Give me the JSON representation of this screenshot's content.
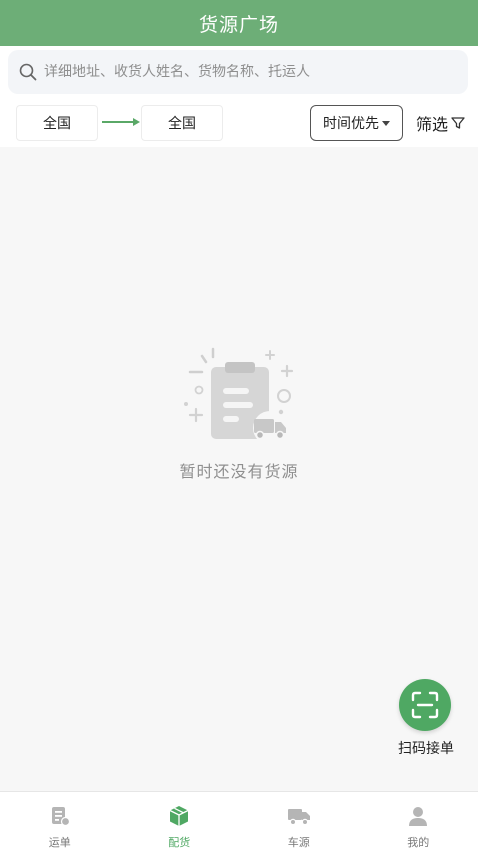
{
  "header": {
    "title": "货源广场"
  },
  "search": {
    "placeholder": "详细地址、收货人姓名、货物名称、托运人"
  },
  "filters": {
    "from_region": "全国",
    "to_region": "全国",
    "sort_label": "时间优先",
    "filter_label": "筛选"
  },
  "empty_state": {
    "message": "暂时还没有货源"
  },
  "scan": {
    "label": "扫码接单"
  },
  "bottom_nav": {
    "items": [
      {
        "label": "运单",
        "icon": "waybill-icon",
        "active": false
      },
      {
        "label": "配货",
        "icon": "box-icon",
        "active": true
      },
      {
        "label": "车源",
        "icon": "truck-icon",
        "active": false
      },
      {
        "label": "我的",
        "icon": "user-icon",
        "active": false
      }
    ]
  },
  "colors": {
    "brand": "#6dae77",
    "accent": "#4fa863",
    "inactive": "#b5b5b5"
  }
}
